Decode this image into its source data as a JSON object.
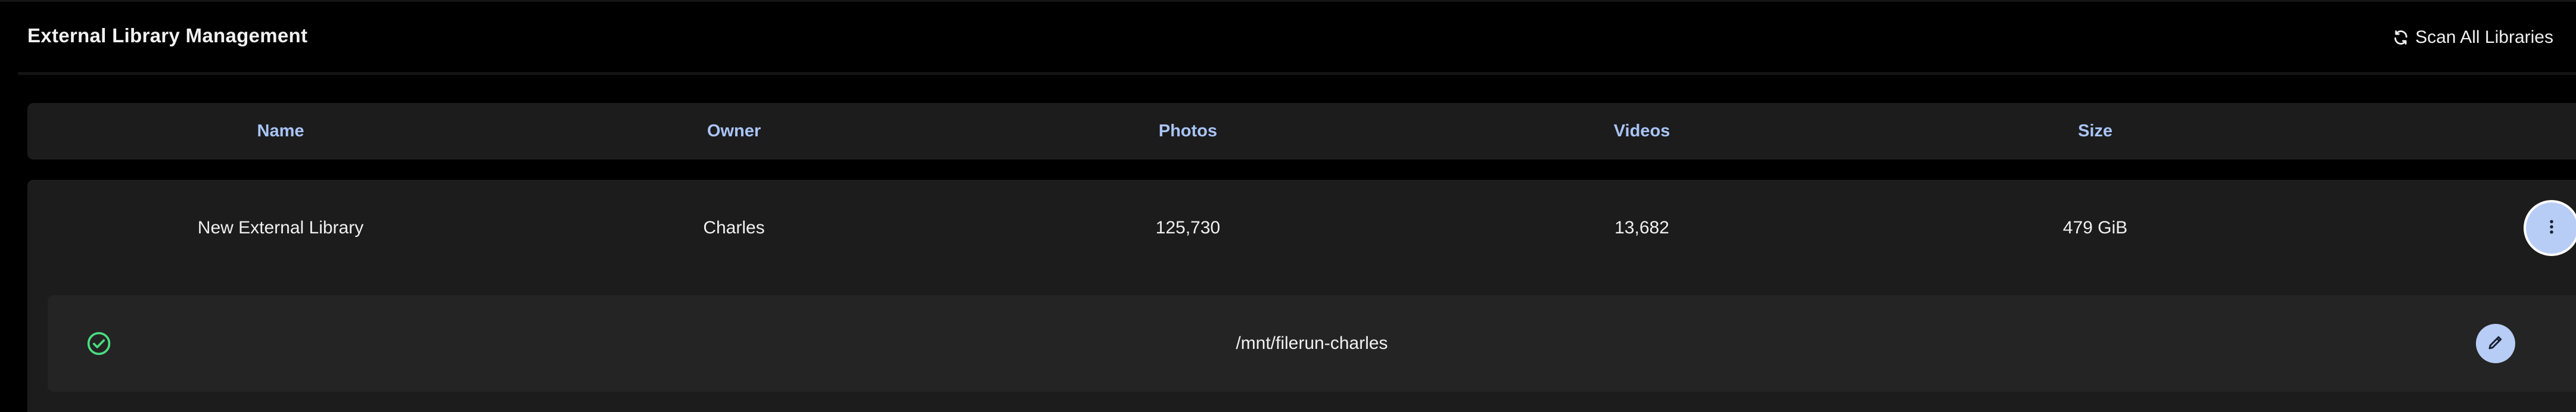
{
  "header": {
    "title": "External Library Management",
    "scan_all_label": "Scan All Libraries",
    "scan_icon": "refresh-icon"
  },
  "table": {
    "columns": [
      "Name",
      "Owner",
      "Photos",
      "Videos",
      "Size"
    ],
    "rows": [
      {
        "name": "New External Library",
        "owner": "Charles",
        "photos": "125,730",
        "videos": "13,682",
        "size": "479 GiB",
        "menu_icon": "more-vertical-icon",
        "paths": [
          {
            "status_icon": "check-circle-icon",
            "path": "/mnt/filerun-charles",
            "edit_icon": "pencil-icon"
          }
        ]
      }
    ]
  },
  "colors": {
    "background": "#000000",
    "surface": "#1c1c1c",
    "surface_inner": "#242424",
    "accent": "#a9c4f7",
    "button_bg": "#b7cdf6",
    "status_ok": "#4ade80"
  }
}
